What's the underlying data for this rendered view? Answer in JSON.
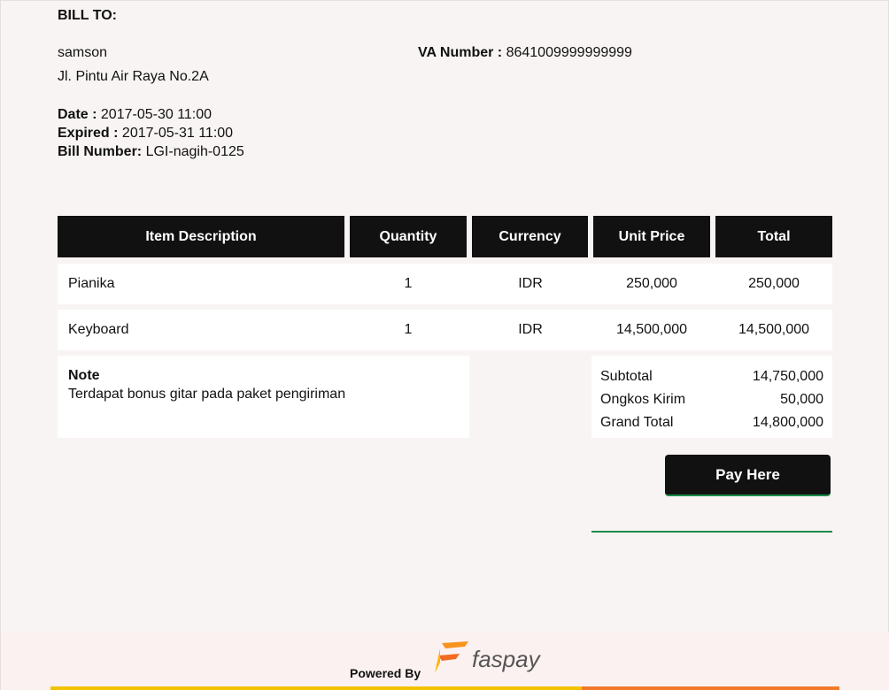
{
  "bill": {
    "bill_to_label": "BILL TO:",
    "customer_name": "samson",
    "customer_address": "Jl. Pintu Air Raya No.2A",
    "va_label": "VA Number :",
    "va_value": "8641009999999999",
    "date_label": "Date :",
    "date_value": "2017-05-30 11:00",
    "expired_label": "Expired :",
    "expired_value": "2017-05-31 11:00",
    "bill_number_label": "Bill Number:",
    "bill_number_value": "LGI-nagih-0125"
  },
  "table": {
    "headers": [
      "Item Description",
      "Quantity",
      "Currency",
      "Unit Price",
      "Total"
    ],
    "rows": [
      {
        "item": "Pianika",
        "qty": "1",
        "currency": "IDR",
        "unit_price": "250,000",
        "total": "250,000"
      },
      {
        "item": "Keyboard",
        "qty": "1",
        "currency": "IDR",
        "unit_price": "14,500,000",
        "total": "14,500,000"
      }
    ]
  },
  "note": {
    "title": "Note",
    "text": "Terdapat bonus gitar pada paket pengiriman"
  },
  "totals": {
    "subtotal_label": "Subtotal",
    "subtotal_value": "14,750,000",
    "shipping_label": "Ongkos Kirim",
    "shipping_value": "50,000",
    "grand_label": "Grand Total",
    "grand_value": "14,800,000"
  },
  "actions": {
    "pay_label": "Pay Here"
  },
  "footer": {
    "powered_by": "Powered By",
    "logo_text": "faspay",
    "colors": {
      "bar_yellow": "#f2c200",
      "bar_orange": "#f07a2a",
      "accent_green": "#1a8a4a"
    }
  }
}
